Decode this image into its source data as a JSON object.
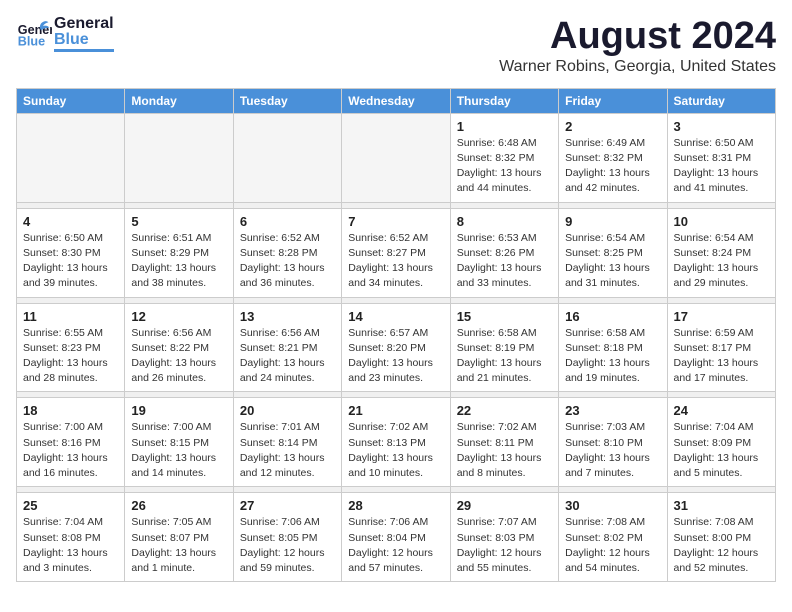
{
  "header": {
    "logo_general": "General",
    "logo_blue": "Blue",
    "month_title": "August 2024",
    "location": "Warner Robins, Georgia, United States"
  },
  "weekdays": [
    "Sunday",
    "Monday",
    "Tuesday",
    "Wednesday",
    "Thursday",
    "Friday",
    "Saturday"
  ],
  "weeks": [
    [
      {
        "day": "",
        "info": ""
      },
      {
        "day": "",
        "info": ""
      },
      {
        "day": "",
        "info": ""
      },
      {
        "day": "",
        "info": ""
      },
      {
        "day": "1",
        "info": "Sunrise: 6:48 AM\nSunset: 8:32 PM\nDaylight: 13 hours\nand 44 minutes."
      },
      {
        "day": "2",
        "info": "Sunrise: 6:49 AM\nSunset: 8:32 PM\nDaylight: 13 hours\nand 42 minutes."
      },
      {
        "day": "3",
        "info": "Sunrise: 6:50 AM\nSunset: 8:31 PM\nDaylight: 13 hours\nand 41 minutes."
      }
    ],
    [
      {
        "day": "4",
        "info": "Sunrise: 6:50 AM\nSunset: 8:30 PM\nDaylight: 13 hours\nand 39 minutes."
      },
      {
        "day": "5",
        "info": "Sunrise: 6:51 AM\nSunset: 8:29 PM\nDaylight: 13 hours\nand 38 minutes."
      },
      {
        "day": "6",
        "info": "Sunrise: 6:52 AM\nSunset: 8:28 PM\nDaylight: 13 hours\nand 36 minutes."
      },
      {
        "day": "7",
        "info": "Sunrise: 6:52 AM\nSunset: 8:27 PM\nDaylight: 13 hours\nand 34 minutes."
      },
      {
        "day": "8",
        "info": "Sunrise: 6:53 AM\nSunset: 8:26 PM\nDaylight: 13 hours\nand 33 minutes."
      },
      {
        "day": "9",
        "info": "Sunrise: 6:54 AM\nSunset: 8:25 PM\nDaylight: 13 hours\nand 31 minutes."
      },
      {
        "day": "10",
        "info": "Sunrise: 6:54 AM\nSunset: 8:24 PM\nDaylight: 13 hours\nand 29 minutes."
      }
    ],
    [
      {
        "day": "11",
        "info": "Sunrise: 6:55 AM\nSunset: 8:23 PM\nDaylight: 13 hours\nand 28 minutes."
      },
      {
        "day": "12",
        "info": "Sunrise: 6:56 AM\nSunset: 8:22 PM\nDaylight: 13 hours\nand 26 minutes."
      },
      {
        "day": "13",
        "info": "Sunrise: 6:56 AM\nSunset: 8:21 PM\nDaylight: 13 hours\nand 24 minutes."
      },
      {
        "day": "14",
        "info": "Sunrise: 6:57 AM\nSunset: 8:20 PM\nDaylight: 13 hours\nand 23 minutes."
      },
      {
        "day": "15",
        "info": "Sunrise: 6:58 AM\nSunset: 8:19 PM\nDaylight: 13 hours\nand 21 minutes."
      },
      {
        "day": "16",
        "info": "Sunrise: 6:58 AM\nSunset: 8:18 PM\nDaylight: 13 hours\nand 19 minutes."
      },
      {
        "day": "17",
        "info": "Sunrise: 6:59 AM\nSunset: 8:17 PM\nDaylight: 13 hours\nand 17 minutes."
      }
    ],
    [
      {
        "day": "18",
        "info": "Sunrise: 7:00 AM\nSunset: 8:16 PM\nDaylight: 13 hours\nand 16 minutes."
      },
      {
        "day": "19",
        "info": "Sunrise: 7:00 AM\nSunset: 8:15 PM\nDaylight: 13 hours\nand 14 minutes."
      },
      {
        "day": "20",
        "info": "Sunrise: 7:01 AM\nSunset: 8:14 PM\nDaylight: 13 hours\nand 12 minutes."
      },
      {
        "day": "21",
        "info": "Sunrise: 7:02 AM\nSunset: 8:13 PM\nDaylight: 13 hours\nand 10 minutes."
      },
      {
        "day": "22",
        "info": "Sunrise: 7:02 AM\nSunset: 8:11 PM\nDaylight: 13 hours\nand 8 minutes."
      },
      {
        "day": "23",
        "info": "Sunrise: 7:03 AM\nSunset: 8:10 PM\nDaylight: 13 hours\nand 7 minutes."
      },
      {
        "day": "24",
        "info": "Sunrise: 7:04 AM\nSunset: 8:09 PM\nDaylight: 13 hours\nand 5 minutes."
      }
    ],
    [
      {
        "day": "25",
        "info": "Sunrise: 7:04 AM\nSunset: 8:08 PM\nDaylight: 13 hours\nand 3 minutes."
      },
      {
        "day": "26",
        "info": "Sunrise: 7:05 AM\nSunset: 8:07 PM\nDaylight: 13 hours\nand 1 minute."
      },
      {
        "day": "27",
        "info": "Sunrise: 7:06 AM\nSunset: 8:05 PM\nDaylight: 12 hours\nand 59 minutes."
      },
      {
        "day": "28",
        "info": "Sunrise: 7:06 AM\nSunset: 8:04 PM\nDaylight: 12 hours\nand 57 minutes."
      },
      {
        "day": "29",
        "info": "Sunrise: 7:07 AM\nSunset: 8:03 PM\nDaylight: 12 hours\nand 55 minutes."
      },
      {
        "day": "30",
        "info": "Sunrise: 7:08 AM\nSunset: 8:02 PM\nDaylight: 12 hours\nand 54 minutes."
      },
      {
        "day": "31",
        "info": "Sunrise: 7:08 AM\nSunset: 8:00 PM\nDaylight: 12 hours\nand 52 minutes."
      }
    ]
  ]
}
